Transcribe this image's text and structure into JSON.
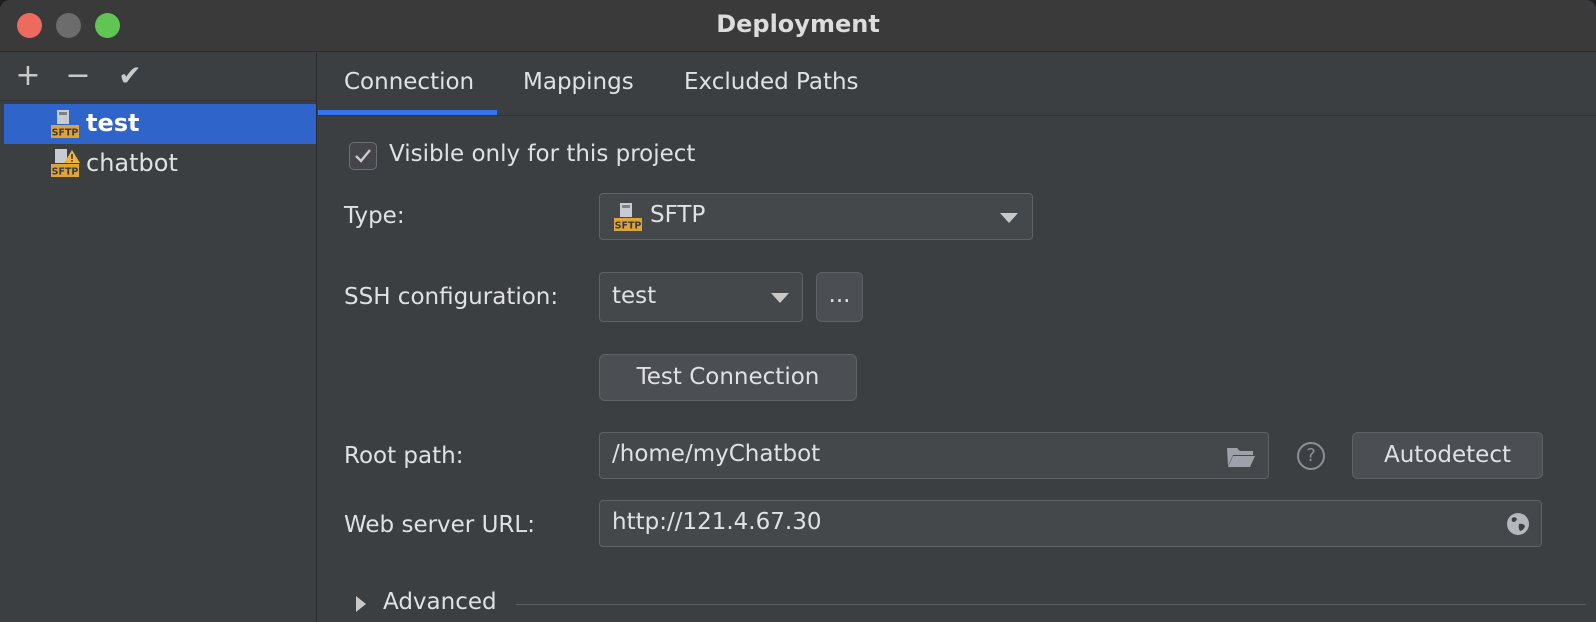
{
  "window": {
    "title": "Deployment"
  },
  "toolbar": {
    "add": "+",
    "remove": "−",
    "apply": "✔"
  },
  "servers": [
    {
      "label": "test",
      "selected": true,
      "warning": false
    },
    {
      "label": "chatbot",
      "selected": false,
      "warning": true
    }
  ],
  "tabs": [
    {
      "label": "Connection",
      "active": true
    },
    {
      "label": "Mappings",
      "active": false
    },
    {
      "label": "Excluded Paths",
      "active": false
    }
  ],
  "connection": {
    "visible_only_label": "Visible only for this project",
    "visible_only_checked": true,
    "type_label": "Type:",
    "type_value": "SFTP",
    "ssh_label": "SSH configuration:",
    "ssh_value": "test",
    "ssh_more_label": "...",
    "test_connection_label": "Test Connection",
    "root_path_label": "Root path:",
    "root_path_value": "/home/myChatbot",
    "autodetect_label": "Autodetect",
    "web_url_label": "Web server URL:",
    "web_url_value": "http://121.4.67.30",
    "advanced_label": "Advanced"
  },
  "icons": {
    "sftp": "sftp-server-icon",
    "folder": "folder-icon",
    "help": "help-icon",
    "globe": "globe-icon"
  },
  "colors": {
    "accent": "#3574f0",
    "selection": "#2f65ca",
    "sftp_badge": "#e0a33a",
    "warning": "#f0b43c"
  }
}
